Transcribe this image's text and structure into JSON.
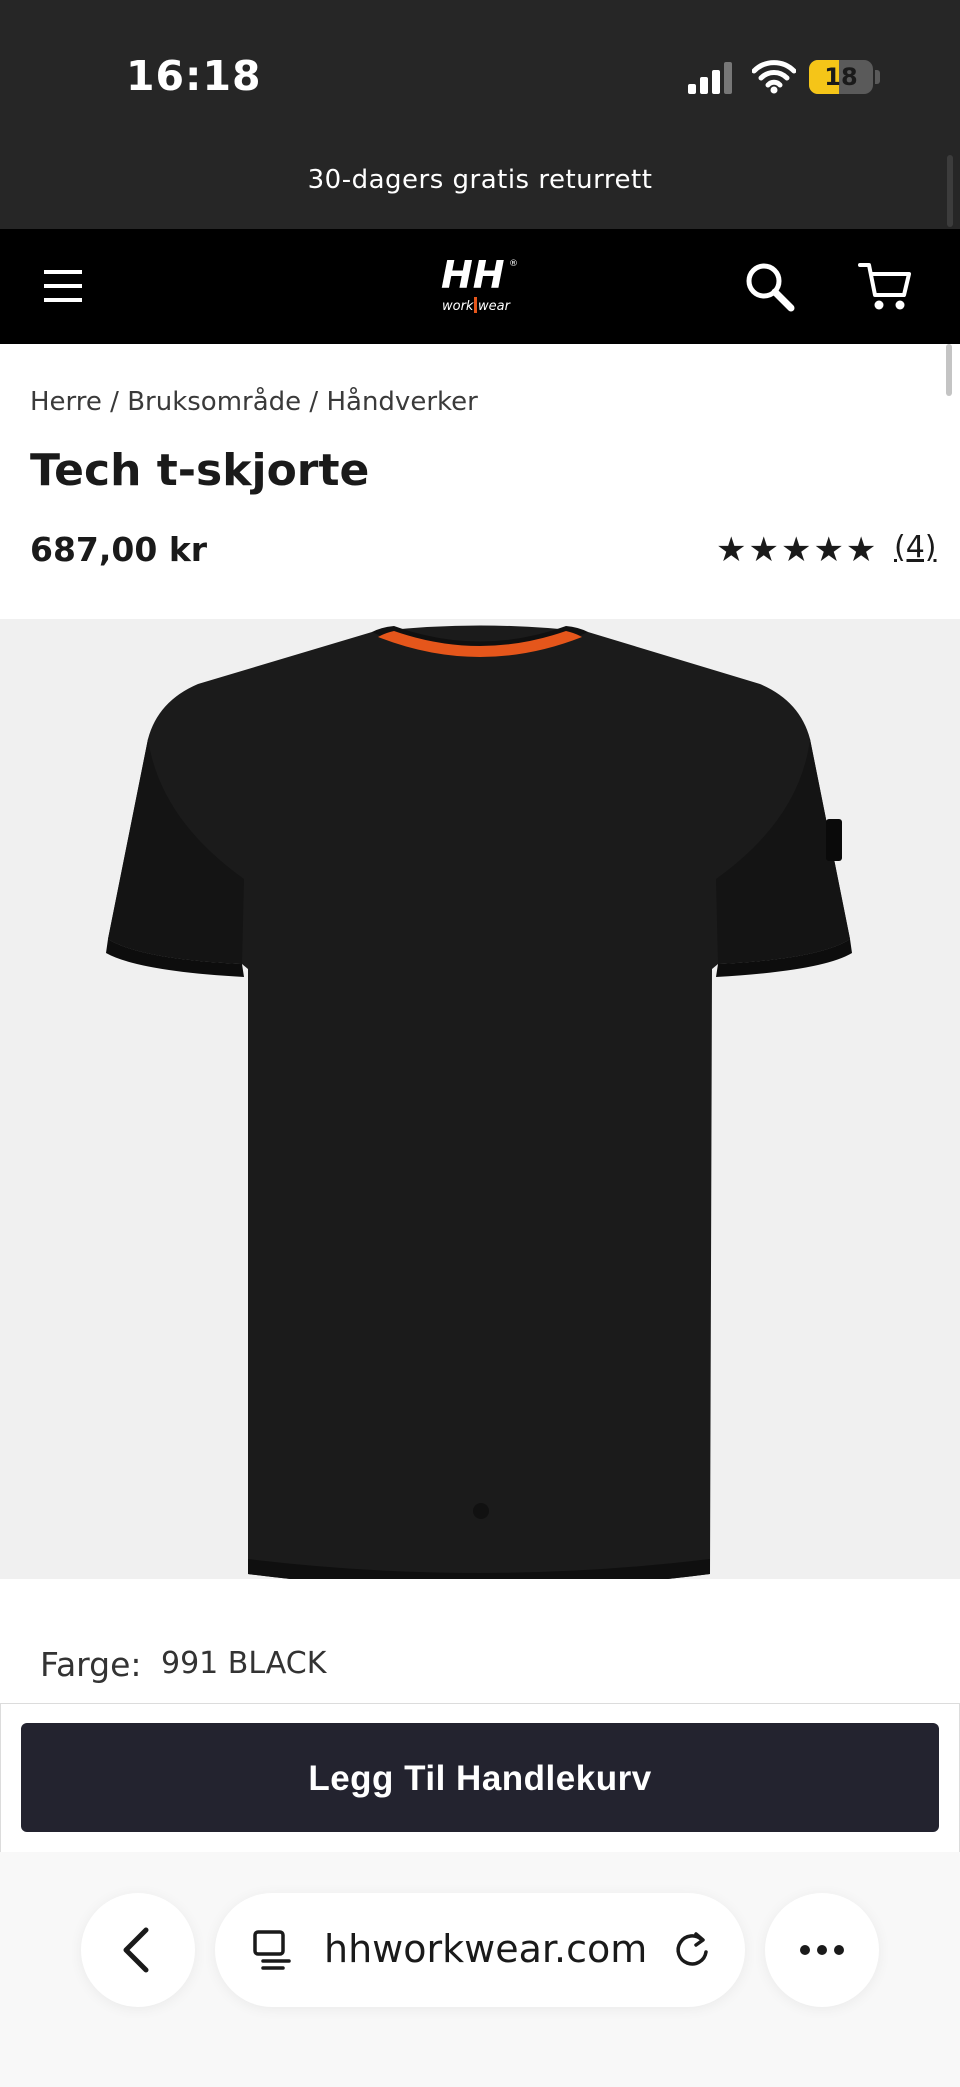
{
  "status_bar": {
    "time": "16:18",
    "battery_level": "18",
    "battery_color": "#f5c518"
  },
  "promo": {
    "text": "30-dagers gratis returrett"
  },
  "nav": {
    "logo_icon": "hh-workwear-logo",
    "menu_icon": "hamburger-menu-icon",
    "search_icon": "search-icon",
    "cart_icon": "cart-icon"
  },
  "breadcrumb": {
    "items": [
      "Herre",
      "Bruksområde",
      "Håndverker"
    ],
    "separator": " / "
  },
  "product": {
    "title": "Tech t-skjorte",
    "price": "687,00 kr",
    "rating_stars": "★★★★★",
    "rating_value": 5,
    "reviews_count": "(4)",
    "image_icon": "black-t-shirt-image",
    "collar_accent_color": "#e5561b",
    "color_label": "Farge:",
    "color_value": "991 BLACK"
  },
  "cart": {
    "button_label": "Legg Til Handlekurv",
    "button_color": "#23232f"
  },
  "browser": {
    "url": "hhworkwear.com"
  }
}
